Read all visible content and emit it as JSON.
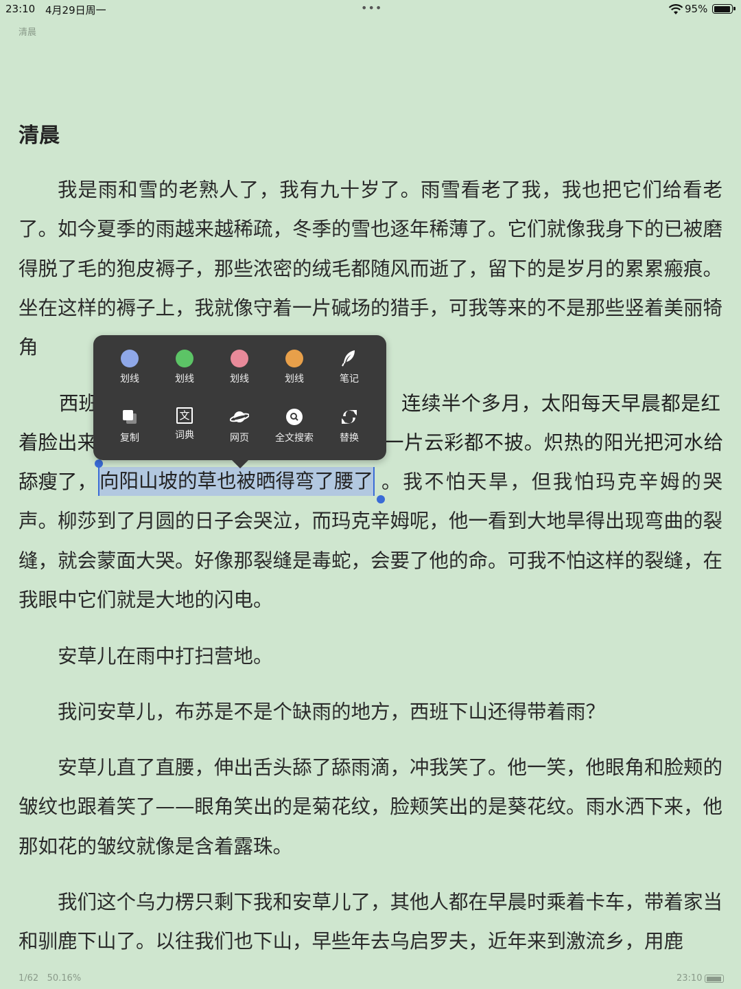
{
  "status_bar": {
    "time": "23:10",
    "date": "4月29日周一",
    "dots": "•••",
    "battery_percent": "95%",
    "battery_level": 0.95
  },
  "running_head": "清晨",
  "chapter_title": "清晨",
  "paragraphs": {
    "p1": "我是雨和雪的老熟人了，我有九十岁了。雨雪看老了我，我也把它们给看老了。如今夏季的雨越来越稀疏，冬季的雪也逐年稀薄了。它们就像我身下的已被磨得脱了毛的狍皮褥子，那些浓密的绒毛都随风而逝了，留下的是岁月的累累瘢痕。坐在这样的褥子上，我就像守着一片碱场的猎手，可我等来的不是那些竖着美丽犄角",
    "p2_before": "西班",
    "p2_right": "连续半个多月，太阳每天早晨都是红",
    "p3_line1_left": "着脸出来",
    "p3_line1_right": "一片云彩都不披。炽热的阳光把河水给",
    "p3_line2_start": "舔瘦了，",
    "selected_text": "向阳山坡的草也被晒得弯了腰了",
    "p3_after": "。我不怕天旱，但我怕玛克辛姆的哭声。柳莎到了月圆的日子会哭泣，而玛克辛姆呢，他一看到大地旱得出现弯曲的裂缝，就会蒙面大哭。好像那裂缝是毒蛇，会要了他的命。可我不怕这样的裂缝，在我眼中它们就是大地的闪电。",
    "p4": "安草儿在雨中打扫营地。",
    "p5": "我问安草儿，布苏是不是个缺雨的地方，西班下山还得带着雨？",
    "p6": "安草儿直了直腰，伸出舌头舔了舔雨滴，冲我笑了。他一笑，他眼角和脸颊的皱纹也跟着笑了——眼角笑出的是菊花纹，脸颊笑出的是葵花纹。雨水洒下来，他那如花的皱纹就像是含着露珠。",
    "p7": "我们这个乌力楞只剩下我和安草儿了，其他人都在早晨时乘着卡车，带着家当和驯鹿下山了。以往我们也下山，早些年去乌启罗夫，近年来到激流乡，用鹿"
  },
  "popup": {
    "row1": [
      {
        "label": "划线",
        "color": "#8fa8e8"
      },
      {
        "label": "划线",
        "color": "#5cc466"
      },
      {
        "label": "划线",
        "color": "#e88a9a"
      },
      {
        "label": "划线",
        "color": "#e8a04a"
      },
      {
        "label": "笔记",
        "icon": "feather-icon"
      }
    ],
    "row2": [
      {
        "label": "复制",
        "icon": "copy-icon"
      },
      {
        "label": "词典",
        "icon": "dictionary-icon",
        "glyph": "文"
      },
      {
        "label": "网页",
        "icon": "planet-icon"
      },
      {
        "label": "全文搜索",
        "icon": "search-icon"
      },
      {
        "label": "替换",
        "icon": "replace-icon"
      }
    ]
  },
  "footer": {
    "page": "1/62",
    "progress": "50.16%",
    "time": "23:10"
  },
  "colors": {
    "background": "#cfe6cf",
    "selection": "#b2c8e0",
    "handle": "#3a6bd6",
    "popup": "#3a3a3a"
  }
}
